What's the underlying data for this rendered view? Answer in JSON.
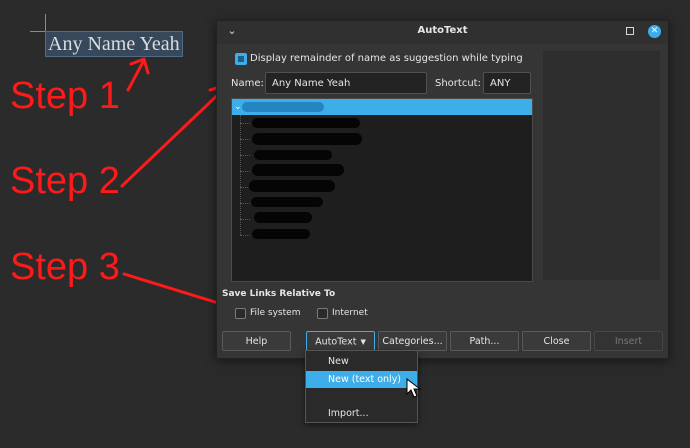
{
  "document": {
    "text": "Any Name Yeah"
  },
  "annotations": {
    "step1": "Step 1",
    "step2": "Step 2",
    "step3": "Step 3",
    "color": "#ff1a1a"
  },
  "dialog": {
    "title": "AutoText",
    "titlebar_icons": [
      "chevron-down-icon",
      "maximize-icon",
      "close-icon"
    ],
    "suggestion_checkbox": {
      "label": "Display remainder of name as suggestion while typing",
      "checked": true
    },
    "name": {
      "label": "Name:",
      "value": "Any Name Yeah"
    },
    "shortcut": {
      "label": "Shortcut:",
      "value": "ANY"
    },
    "tree": {
      "selected_expanded": true,
      "items_redacted": true
    },
    "save_links": {
      "title": "Save Links Relative To",
      "options": [
        {
          "label": "File system",
          "checked": false
        },
        {
          "label": "Internet",
          "checked": false
        }
      ]
    },
    "buttons": {
      "help": "Help",
      "autotext": "AutoText",
      "categories": "Categories...",
      "path": "Path...",
      "close": "Close",
      "insert": "Insert"
    },
    "menu": {
      "items": [
        "New",
        "New (text only)",
        "",
        "Import..."
      ],
      "highlighted": "New (text only)"
    },
    "accent_color": "#3daee9"
  }
}
